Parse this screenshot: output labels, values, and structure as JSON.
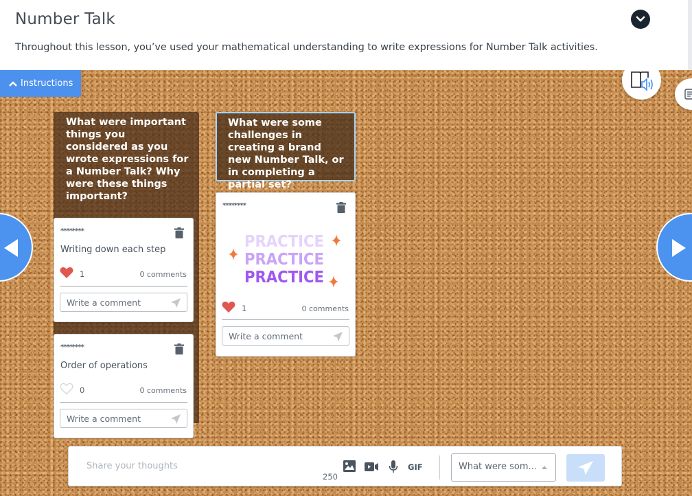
{
  "header": {
    "title": "Number Talk",
    "subtitle": "Throughout this lesson, you’ve used your mathematical understanding to write expressions for Number Talk activities.",
    "collapse_icon": "chevron-down-icon"
  },
  "board": {
    "instructions_label": "Instructions",
    "audio_icon": "read-aloud-icon",
    "notes_icon": "notes-icon",
    "prev_icon": "arrow-left-icon",
    "next_icon": "arrow-right-icon"
  },
  "columns": [
    {
      "prompt": "What were important things you considered as you wrote expressions for a Number Talk? Why were these things important?",
      "cards": [
        {
          "author": "********",
          "text": "Writing down each step",
          "liked": true,
          "likes": "1",
          "comments": "0 comments",
          "comment_placeholder": "Write a comment"
        },
        {
          "author": "********",
          "text": "Order of operations",
          "liked": false,
          "likes": "0",
          "comments": "0 comments",
          "comment_placeholder": "Write a comment"
        }
      ]
    },
    {
      "prompt": "What were some challenges in creating a brand new Number Talk, or in completing a partial set?",
      "cards": [
        {
          "author": "********",
          "image_words": [
            "PRACTICE",
            "PRACTICE",
            "PRACTICE"
          ],
          "liked": true,
          "likes": "1",
          "comments": "0 comments",
          "comment_placeholder": "Write a comment"
        }
      ]
    }
  ],
  "composer": {
    "placeholder": "Share your thoughts",
    "char_count": "250",
    "tools": [
      "image-icon",
      "video-icon",
      "microphone-icon"
    ],
    "gif_label": "GIF",
    "topic_selected": "What were som...",
    "send_icon": "send-icon"
  },
  "colors": {
    "accent": "#4c93ef",
    "like": "#e0574f",
    "practice": [
      "#e5d3fb",
      "#c9a4f6",
      "#a057f0"
    ],
    "sparkle": "#f07a3c"
  }
}
